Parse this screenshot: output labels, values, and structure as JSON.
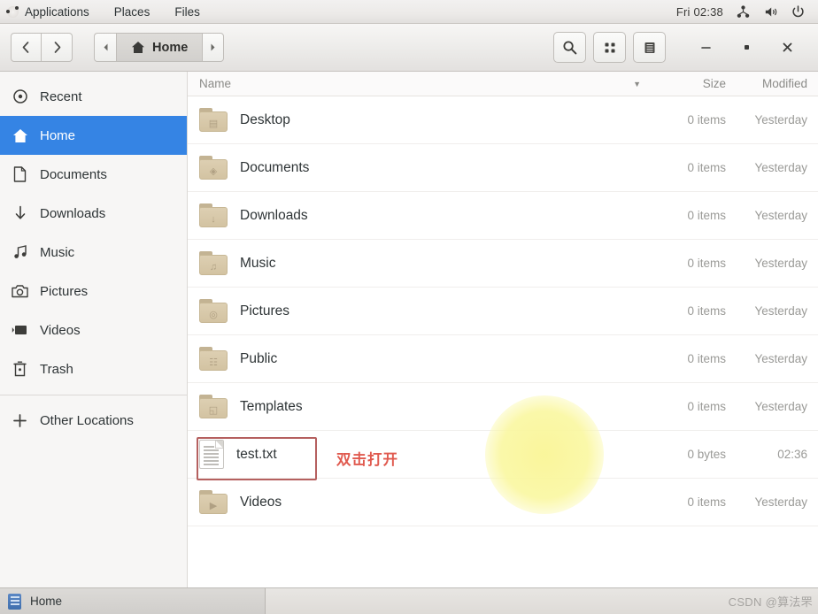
{
  "topbar": {
    "logo_icon": "ubuntu-logo-icon",
    "menus": [
      {
        "label": "Applications",
        "name": "applications-menu"
      },
      {
        "label": "Places",
        "name": "places-menu"
      },
      {
        "label": "Files",
        "name": "files-menu"
      }
    ],
    "clock": "Fri 02:38",
    "status_icons": [
      "network-icon",
      "volume-icon",
      "power-icon"
    ]
  },
  "headerbar": {
    "back_icon": "chevron-left-icon",
    "forward_icon": "chevron-right-icon",
    "path_prev_icon": "triangle-left-icon",
    "path_next_icon": "triangle-right-icon",
    "path_home_label": "Home",
    "path_home_icon": "home-icon",
    "search_icon": "search-icon",
    "grid_view_icon": "grid-view-icon",
    "list_view_icon": "list-view-icon",
    "minimize_label": "–",
    "maximize_label": "■",
    "close_label": "✕"
  },
  "sidebar": {
    "items": [
      {
        "label": "Recent",
        "icon": "clock-icon",
        "selected": false
      },
      {
        "label": "Home",
        "icon": "home-icon",
        "selected": true
      },
      {
        "label": "Documents",
        "icon": "document-icon",
        "selected": false
      },
      {
        "label": "Downloads",
        "icon": "download-arrow-icon",
        "selected": false
      },
      {
        "label": "Music",
        "icon": "music-note-icon",
        "selected": false
      },
      {
        "label": "Pictures",
        "icon": "camera-icon",
        "selected": false
      },
      {
        "label": "Videos",
        "icon": "video-icon",
        "selected": false
      },
      {
        "label": "Trash",
        "icon": "trash-icon",
        "selected": false
      }
    ],
    "other_locations": {
      "label": "Other Locations",
      "icon": "plus-icon"
    }
  },
  "filelist": {
    "columns": {
      "name": "Name",
      "size": "Size",
      "modified": "Modified"
    },
    "sort_icon": "chevron-down-icon",
    "rows": [
      {
        "name": "Desktop",
        "type": "folder",
        "size": "0 items",
        "modified": "Yesterday",
        "glyph": "▤"
      },
      {
        "name": "Documents",
        "type": "folder",
        "size": "0 items",
        "modified": "Yesterday",
        "glyph": "◈"
      },
      {
        "name": "Downloads",
        "type": "folder",
        "size": "0 items",
        "modified": "Yesterday",
        "glyph": "↓"
      },
      {
        "name": "Music",
        "type": "folder",
        "size": "0 items",
        "modified": "Yesterday",
        "glyph": "♫"
      },
      {
        "name": "Pictures",
        "type": "folder",
        "size": "0 items",
        "modified": "Yesterday",
        "glyph": "◎"
      },
      {
        "name": "Public",
        "type": "folder",
        "size": "0 items",
        "modified": "Yesterday",
        "glyph": "☷"
      },
      {
        "name": "Templates",
        "type": "folder",
        "size": "0 items",
        "modified": "Yesterday",
        "glyph": "◱"
      },
      {
        "name": "test.txt",
        "type": "file",
        "size": "0 bytes",
        "modified": "02:36",
        "glyph": ""
      },
      {
        "name": "Videos",
        "type": "folder",
        "size": "0 items",
        "modified": "Yesterday",
        "glyph": "▶"
      }
    ]
  },
  "annotations": {
    "highlight_target": "test.txt",
    "instruction_text": "双击打开",
    "box_color": "#b5605f",
    "text_color": "#e05a4f",
    "click_glow_color": "#f9f596"
  },
  "taskbar": {
    "window_label": "Home",
    "window_icon": "file-manager-icon",
    "watermark": "CSDN @算法罘"
  }
}
